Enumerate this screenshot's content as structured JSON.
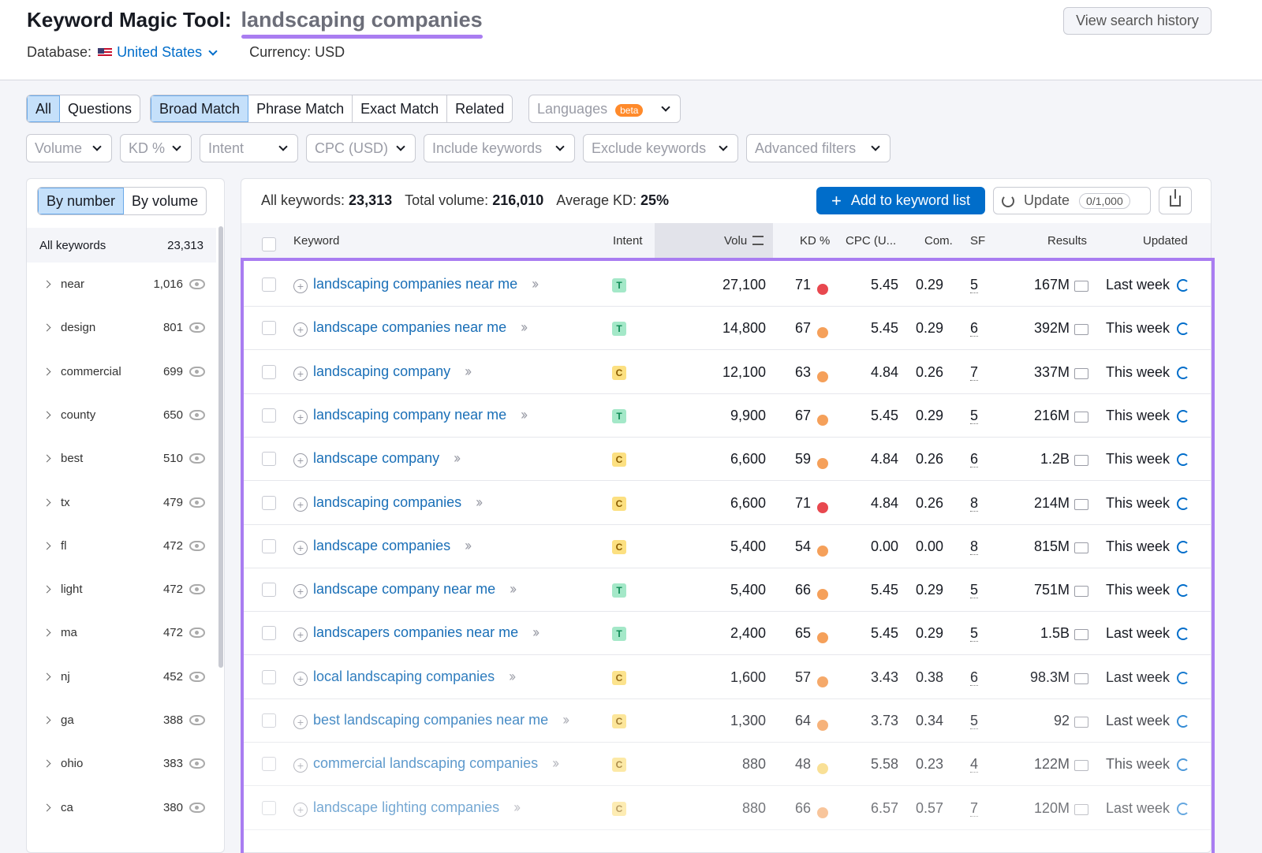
{
  "header": {
    "tool_title": "Keyword Magic Tool:",
    "query": "landscaping companies",
    "database_label": "Database:",
    "database_value": "United States",
    "currency": "Currency: USD",
    "history_button": "View search history"
  },
  "tabs": {
    "all": "All",
    "questions": "Questions",
    "broad": "Broad Match",
    "phrase": "Phrase Match",
    "exact": "Exact Match",
    "related": "Related",
    "languages": "Languages",
    "beta": "beta"
  },
  "filters": {
    "volume": "Volume",
    "kd": "KD %",
    "intent": "Intent",
    "cpc": "CPC (USD)",
    "include": "Include keywords",
    "exclude": "Exclude keywords",
    "advanced": "Advanced filters"
  },
  "groups": {
    "by_number": "By number",
    "by_volume": "By volume",
    "all_label": "All keywords",
    "all_count": "23,313",
    "items": [
      {
        "name": "near",
        "count": "1,016"
      },
      {
        "name": "design",
        "count": "801"
      },
      {
        "name": "commercial",
        "count": "699"
      },
      {
        "name": "county",
        "count": "650"
      },
      {
        "name": "best",
        "count": "510"
      },
      {
        "name": "tx",
        "count": "479"
      },
      {
        "name": "fl",
        "count": "472"
      },
      {
        "name": "light",
        "count": "472"
      },
      {
        "name": "ma",
        "count": "472"
      },
      {
        "name": "nj",
        "count": "452"
      },
      {
        "name": "ga",
        "count": "388"
      },
      {
        "name": "ohio",
        "count": "383"
      },
      {
        "name": "ca",
        "count": "380"
      }
    ]
  },
  "summary": {
    "all_keywords_label": "All keywords:",
    "all_keywords": "23,313",
    "total_volume_label": "Total volume:",
    "total_volume": "216,010",
    "avg_kd_label": "Average KD:",
    "avg_kd": "25%",
    "add_button": "Add to keyword list",
    "update_button": "Update",
    "update_counter": "0/1,000"
  },
  "columns": {
    "keyword": "Keyword",
    "intent": "Intent",
    "volume": "Volu",
    "kd": "KD %",
    "cpc": "CPC (U...",
    "com": "Com.",
    "sf": "SF",
    "results": "Results",
    "updated": "Updated"
  },
  "kd_colors": {
    "high": "#e8484f",
    "difficult": "#f5a05a",
    "possible": "#f7d36b"
  },
  "rows": [
    {
      "keyword": "landscaping companies near me",
      "intent": "T",
      "volume": "27,100",
      "kd": "71",
      "kd_level": "high",
      "cpc": "5.45",
      "com": "0.29",
      "sf": "5",
      "results": "167M",
      "updated": "Last week"
    },
    {
      "keyword": "landscape companies near me",
      "intent": "T",
      "volume": "14,800",
      "kd": "67",
      "kd_level": "difficult",
      "cpc": "5.45",
      "com": "0.29",
      "sf": "6",
      "results": "392M",
      "updated": "This week"
    },
    {
      "keyword": "landscaping company",
      "intent": "C",
      "volume": "12,100",
      "kd": "63",
      "kd_level": "difficult",
      "cpc": "4.84",
      "com": "0.26",
      "sf": "7",
      "results": "337M",
      "updated": "This week"
    },
    {
      "keyword": "landscaping company near me",
      "intent": "T",
      "volume": "9,900",
      "kd": "67",
      "kd_level": "difficult",
      "cpc": "5.45",
      "com": "0.29",
      "sf": "5",
      "results": "216M",
      "updated": "This week"
    },
    {
      "keyword": "landscape company",
      "intent": "C",
      "volume": "6,600",
      "kd": "59",
      "kd_level": "difficult",
      "cpc": "4.84",
      "com": "0.26",
      "sf": "6",
      "results": "1.2B",
      "updated": "This week"
    },
    {
      "keyword": "landscaping companies",
      "intent": "C",
      "volume": "6,600",
      "kd": "71",
      "kd_level": "high",
      "cpc": "4.84",
      "com": "0.26",
      "sf": "8",
      "results": "214M",
      "updated": "This week"
    },
    {
      "keyword": "landscape companies",
      "intent": "C",
      "volume": "5,400",
      "kd": "54",
      "kd_level": "difficult",
      "cpc": "0.00",
      "com": "0.00",
      "sf": "8",
      "results": "815M",
      "updated": "This week"
    },
    {
      "keyword": "landscape company near me",
      "intent": "T",
      "volume": "5,400",
      "kd": "66",
      "kd_level": "difficult",
      "cpc": "5.45",
      "com": "0.29",
      "sf": "5",
      "results": "751M",
      "updated": "This week"
    },
    {
      "keyword": "landscapers companies near me",
      "intent": "T",
      "volume": "2,400",
      "kd": "65",
      "kd_level": "difficult",
      "cpc": "5.45",
      "com": "0.29",
      "sf": "5",
      "results": "1.5B",
      "updated": "Last week"
    },
    {
      "keyword": "local landscaping companies",
      "intent": "C",
      "volume": "1,600",
      "kd": "57",
      "kd_level": "difficult",
      "cpc": "3.43",
      "com": "0.38",
      "sf": "6",
      "results": "98.3M",
      "updated": "Last week"
    },
    {
      "keyword": "best landscaping companies near me",
      "intent": "C",
      "volume": "1,300",
      "kd": "64",
      "kd_level": "difficult",
      "cpc": "3.73",
      "com": "0.34",
      "sf": "5",
      "results": "92",
      "updated": "Last week"
    },
    {
      "keyword": "commercial landscaping companies",
      "intent": "C",
      "volume": "880",
      "kd": "48",
      "kd_level": "possible",
      "cpc": "5.58",
      "com": "0.23",
      "sf": "4",
      "results": "122M",
      "updated": "This week"
    },
    {
      "keyword": "landscape lighting companies",
      "intent": "C",
      "volume": "880",
      "kd": "66",
      "kd_level": "difficult",
      "cpc": "6.57",
      "com": "0.57",
      "sf": "7",
      "results": "120M",
      "updated": "Last week"
    }
  ]
}
